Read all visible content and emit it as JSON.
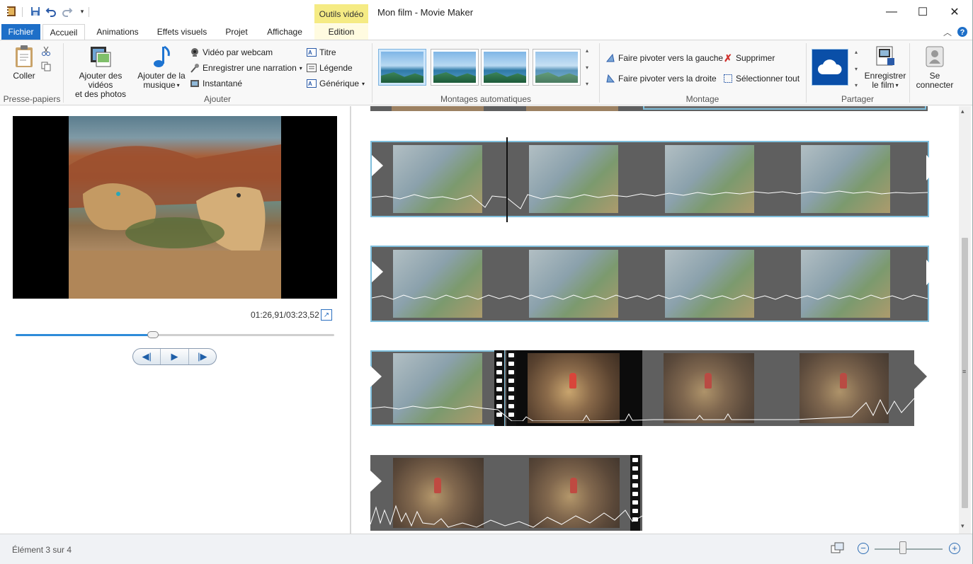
{
  "window": {
    "title": "Mon film - Movie Maker",
    "context_tab_label": "Outils vidéo",
    "minimize_glyph": "—",
    "maximize_glyph": "☐",
    "close_glyph": "✕"
  },
  "quick_access": {
    "icons": [
      "app-icon",
      "save-icon",
      "undo-icon",
      "redo-icon",
      "customize-icon"
    ]
  },
  "tabs": {
    "fichier": "Fichier",
    "accueil": "Accueil",
    "animations": "Animations",
    "effets": "Effets visuels",
    "projet": "Projet",
    "affichage": "Affichage",
    "edition": "Edition"
  },
  "ribbon": {
    "presse_papiers": {
      "group_label": "Presse-papiers",
      "coller": "Coller"
    },
    "ajouter": {
      "group_label": "Ajouter",
      "add_videos_line1": "Ajouter des vidéos",
      "add_videos_line2": "et des photos",
      "add_music_line1": "Ajouter de la",
      "add_music_line2": "musique",
      "webcam": "Vidéo par webcam",
      "narration": "Enregistrer une narration",
      "snapshot": "Instantané",
      "title": "Titre",
      "caption": "Légende",
      "credits": "Générique"
    },
    "montages": {
      "group_label": "Montages automatiques"
    },
    "montage": {
      "group_label": "Montage",
      "rotate_left": "Faire pivoter vers la gauche",
      "rotate_right": "Faire pivoter vers la droite",
      "delete": "Supprimer",
      "select_all": "Sélectionner tout"
    },
    "partager": {
      "group_label": "Partager",
      "save_line1": "Enregistrer",
      "save_line2": "le film"
    },
    "sign_in_line1": "Se",
    "sign_in_line2": "connecter"
  },
  "preview": {
    "timecode": "01:26,91/03:23,52",
    "progress": 0.43
  },
  "status": {
    "text": "Élément 3 sur 4",
    "zoom_minus": "−",
    "zoom_plus": "+"
  },
  "colors": {
    "accent": "#1e6fc8",
    "context_tab": "#f5eb84",
    "selection_border": "#7fbfdc"
  }
}
